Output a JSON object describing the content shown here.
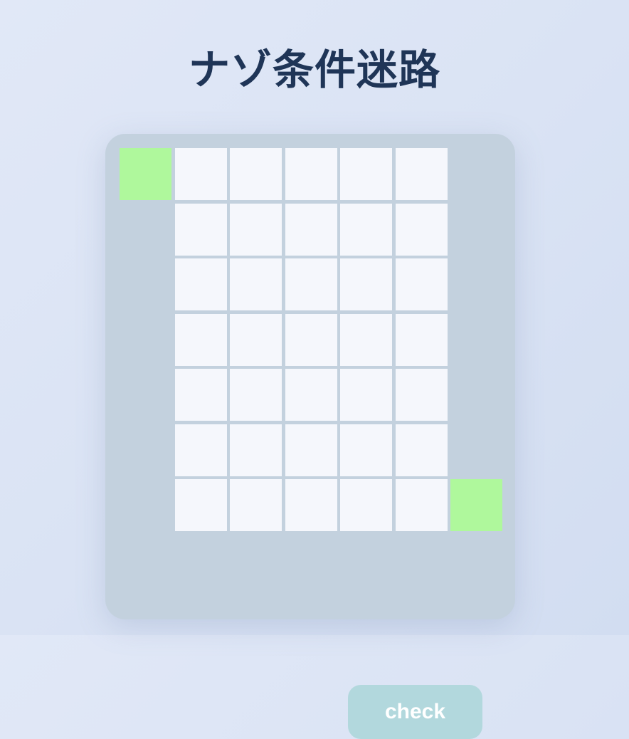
{
  "title": "ナゾ条件迷路",
  "check_button": {
    "label": "check"
  },
  "colors": {
    "background": "#dae3f4",
    "title": "#1f3557",
    "board": "#c3d1de",
    "cell": "#f5f7fc",
    "start_goal": "#aff89c",
    "button": "#b2d8dd",
    "button_text": "#ffffff"
  },
  "maze": {
    "columns": 7,
    "rows": 7,
    "start": {
      "row": 1,
      "col": 1
    },
    "goal": {
      "row": 7,
      "col": 7
    },
    "grid": [
      [
        "start",
        "empty",
        "empty",
        "empty",
        "empty",
        "empty",
        "none"
      ],
      [
        "none",
        "empty",
        "empty",
        "empty",
        "empty",
        "empty",
        "none"
      ],
      [
        "none",
        "empty",
        "empty",
        "empty",
        "empty",
        "empty",
        "none"
      ],
      [
        "none",
        "empty",
        "empty",
        "empty",
        "empty",
        "empty",
        "none"
      ],
      [
        "none",
        "empty",
        "empty",
        "empty",
        "empty",
        "empty",
        "none"
      ],
      [
        "none",
        "empty",
        "empty",
        "empty",
        "empty",
        "empty",
        "none"
      ],
      [
        "none",
        "empty",
        "empty",
        "empty",
        "empty",
        "empty",
        "goal"
      ]
    ]
  }
}
